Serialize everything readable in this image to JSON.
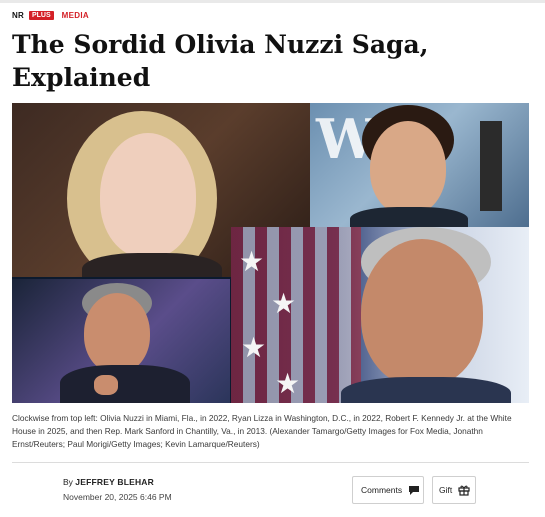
{
  "kicker": {
    "brand": "NR",
    "brand_badge": "PLUS",
    "section": "MEDIA"
  },
  "headline": "The Sordid Olivia Nuzzi Saga, Explained",
  "collage": {
    "photos": [
      {
        "subject": "Olivia Nuzzi"
      },
      {
        "subject": "Ryan Lizza"
      },
      {
        "subject": "Mark Sanford"
      },
      {
        "subject": "Robert F. Kennedy Jr."
      }
    ]
  },
  "caption": "Clockwise from top left: Olivia Nuzzi in Miami, Fla., in 2022, Ryan Lizza in Washington, D.C., in 2022, Robert F. Kennedy Jr. at the White House in 2025, and then Rep. Mark Sanford in Chantilly, Va., in 2013. (Alexander Tamargo/Getty Images for Fox Media, Jonathn Ernst/Reuters; Paul Morigi/Getty Images; Kevin Lamarque/Reuters)",
  "byline": {
    "prefix": "By",
    "author": "JEFFREY BLEHAR",
    "date": "November 20, 2025 6:46 PM"
  },
  "actions": {
    "comments_label": "Comments",
    "gift_label": "Gift"
  },
  "icons": {
    "comments": "speech-bubble-icon",
    "gift": "gift-icon"
  },
  "colors": {
    "accent": "#d42027",
    "headline": "#111111"
  }
}
